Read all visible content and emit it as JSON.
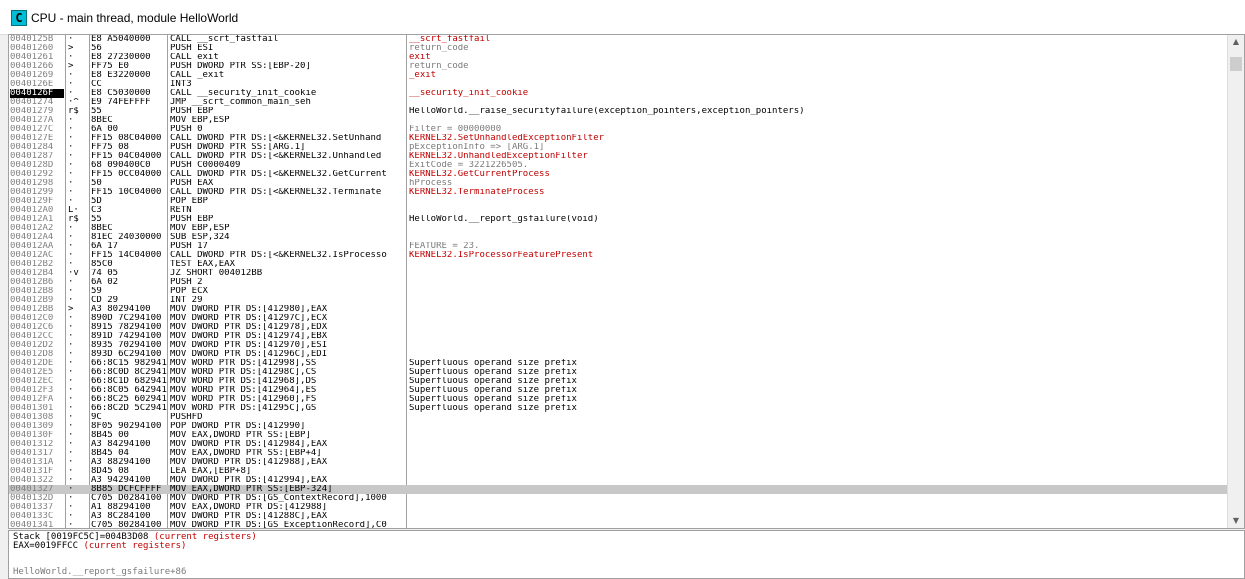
{
  "window": {
    "title": "CPU - main thread, module HelloWorld",
    "icon_letter": "C"
  },
  "disasm": [
    {
      "addr": "0040125B",
      "glyph": "·",
      "hex": "E8 A5040000",
      "dis": "CALL __scrt_fastfail",
      "comment": "__scrt_fastfail",
      "cstyle": "red"
    },
    {
      "addr": "00401260",
      "glyph": ">",
      "hex": "56",
      "dis": "PUSH ESI",
      "comment": "return_code",
      "cstyle": "gray"
    },
    {
      "addr": "00401261",
      "glyph": "·",
      "hex": "E8 27230000",
      "dis": "CALL exit",
      "comment": "exit",
      "cstyle": "red"
    },
    {
      "addr": "00401266",
      "glyph": ">",
      "hex": "FF75 E0",
      "dis": "PUSH DWORD PTR SS:[EBP-20]",
      "comment": "return_code",
      "cstyle": "gray"
    },
    {
      "addr": "00401269",
      "glyph": "·",
      "hex": "E8 E3220000",
      "dis": "CALL _exit",
      "comment": "_exit",
      "cstyle": "red"
    },
    {
      "addr": "0040126E",
      "glyph": "·",
      "hex": "CC",
      "dis": "INT3",
      "comment": "",
      "cstyle": ""
    },
    {
      "addr": "0040126F",
      "glyph": "·",
      "hex": "E8 C5030000",
      "dis": "CALL __security_init_cookie",
      "comment": "__security_init_cookie",
      "cstyle": "red"
    },
    {
      "addr": "00401274",
      "glyph": "·^",
      "hex": "E9 74FEFFFF",
      "dis": "JMP __scrt_common_main_seh",
      "comment": "",
      "cstyle": ""
    },
    {
      "addr": "00401279",
      "glyph": "r$",
      "hex": "55",
      "dis": "PUSH EBP",
      "comment": "HelloWorld.__raise_securityfailure(exception_pointers,exception_pointers)",
      "cstyle": ""
    },
    {
      "addr": "0040127A",
      "glyph": "·",
      "hex": "8BEC",
      "dis": "MOV EBP,ESP",
      "comment": "",
      "cstyle": ""
    },
    {
      "addr": "0040127C",
      "glyph": "·",
      "hex": "6A 00",
      "dis": "PUSH 0",
      "comment": "Filter = 00000000",
      "cstyle": "gray"
    },
    {
      "addr": "0040127E",
      "glyph": "·",
      "hex": "FF15 08C04000",
      "dis": "CALL DWORD PTR DS:[<&KERNEL32.SetUnhand",
      "comment": "KERNEL32.SetUnhandledExceptionFilter",
      "cstyle": "red"
    },
    {
      "addr": "00401284",
      "glyph": "·",
      "hex": "FF75 08",
      "dis": "PUSH DWORD PTR SS:[ARG.1]",
      "comment": "pExceptionInfo => [ARG.1]",
      "cstyle": "gray"
    },
    {
      "addr": "00401287",
      "glyph": "·",
      "hex": "FF15 04C04000",
      "dis": "CALL DWORD PTR DS:[<&KERNEL32.Unhandled",
      "comment": "KERNEL32.UnhandledExceptionFilter",
      "cstyle": "red"
    },
    {
      "addr": "0040128D",
      "glyph": "·",
      "hex": "68 090400C0",
      "dis": "PUSH C0000409",
      "comment": "ExitCode = 3221226505.",
      "cstyle": "gray"
    },
    {
      "addr": "00401292",
      "glyph": "·",
      "hex": "FF15 0CC04000",
      "dis": "CALL DWORD PTR DS:[<&KERNEL32.GetCurrent",
      "comment": "KERNEL32.GetCurrentProcess",
      "cstyle": "red"
    },
    {
      "addr": "00401298",
      "glyph": "·",
      "hex": "50",
      "dis": "PUSH EAX",
      "comment": "hProcess",
      "cstyle": "gray"
    },
    {
      "addr": "00401299",
      "glyph": "·",
      "hex": "FF15 10C04000",
      "dis": "CALL DWORD PTR DS:[<&KERNEL32.Terminate",
      "comment": "KERNEL32.TerminateProcess",
      "cstyle": "red"
    },
    {
      "addr": "0040129F",
      "glyph": "·",
      "hex": "5D",
      "dis": "POP EBP",
      "comment": "",
      "cstyle": ""
    },
    {
      "addr": "004012A0",
      "glyph": "L·",
      "hex": "C3",
      "dis": "RETN",
      "comment": "",
      "cstyle": ""
    },
    {
      "addr": "004012A1",
      "glyph": "r$",
      "hex": "55",
      "dis": "PUSH EBP",
      "comment": "HelloWorld.__report_gsfailure(void)",
      "cstyle": ""
    },
    {
      "addr": "004012A2",
      "glyph": "·",
      "hex": "8BEC",
      "dis": "MOV EBP,ESP",
      "comment": "",
      "cstyle": ""
    },
    {
      "addr": "004012A4",
      "glyph": "·",
      "hex": "81EC 24030000",
      "dis": "SUB ESP,324",
      "comment": "",
      "cstyle": ""
    },
    {
      "addr": "004012AA",
      "glyph": "·",
      "hex": "6A 17",
      "dis": "PUSH 17",
      "comment": "FEATURE = 23.",
      "cstyle": "gray"
    },
    {
      "addr": "004012AC",
      "glyph": "·",
      "hex": "FF15 14C04000",
      "dis": "CALL DWORD PTR DS:[<&KERNEL32.IsProcesso",
      "comment": "KERNEL32.IsProcessorFeaturePresent",
      "cstyle": "red"
    },
    {
      "addr": "004012B2",
      "glyph": "·",
      "hex": "85C0",
      "dis": "TEST EAX,EAX",
      "comment": "",
      "cstyle": ""
    },
    {
      "addr": "004012B4",
      "glyph": "·v",
      "hex": "74 05",
      "dis": "JZ SHORT 004012BB",
      "comment": "",
      "cstyle": ""
    },
    {
      "addr": "004012B6",
      "glyph": "·",
      "hex": "6A 02",
      "dis": "PUSH 2",
      "comment": "",
      "cstyle": ""
    },
    {
      "addr": "004012B8",
      "glyph": "·",
      "hex": "59",
      "dis": "POP ECX",
      "comment": "",
      "cstyle": ""
    },
    {
      "addr": "004012B9",
      "glyph": "·",
      "hex": "CD 29",
      "dis": "INT 29",
      "comment": "",
      "cstyle": ""
    },
    {
      "addr": "004012BB",
      "glyph": ">",
      "hex": "A3 80294100",
      "dis": "MOV DWORD PTR DS:[412980],EAX",
      "comment": "",
      "cstyle": ""
    },
    {
      "addr": "004012C0",
      "glyph": "·",
      "hex": "890D 7C294100",
      "dis": "MOV DWORD PTR DS:[41297C],ECX",
      "comment": "",
      "cstyle": ""
    },
    {
      "addr": "004012C6",
      "glyph": "·",
      "hex": "8915 78294100",
      "dis": "MOV DWORD PTR DS:[412978],EDX",
      "comment": "",
      "cstyle": ""
    },
    {
      "addr": "004012CC",
      "glyph": "·",
      "hex": "891D 74294100",
      "dis": "MOV DWORD PTR DS:[412974],EBX",
      "comment": "",
      "cstyle": ""
    },
    {
      "addr": "004012D2",
      "glyph": "·",
      "hex": "8935 70294100",
      "dis": "MOV DWORD PTR DS:[412970],ESI",
      "comment": "",
      "cstyle": ""
    },
    {
      "addr": "004012D8",
      "glyph": "·",
      "hex": "893D 6C294100",
      "dis": "MOV DWORD PTR DS:[41296C],EDI",
      "comment": "",
      "cstyle": ""
    },
    {
      "addr": "004012DE",
      "glyph": "·",
      "hex": "66:8C15 98294100",
      "dis": "MOV WORD PTR DS:[412998],SS",
      "comment": "Superfluous operand size prefix",
      "cstyle": ""
    },
    {
      "addr": "004012E5",
      "glyph": "·",
      "hex": "66:8C0D 8C294100",
      "dis": "MOV WORD PTR DS:[41298C],CS",
      "comment": "Superfluous operand size prefix",
      "cstyle": ""
    },
    {
      "addr": "004012EC",
      "glyph": "·",
      "hex": "66:8C1D 68294100",
      "dis": "MOV WORD PTR DS:[412968],DS",
      "comment": "Superfluous operand size prefix",
      "cstyle": ""
    },
    {
      "addr": "004012F3",
      "glyph": "·",
      "hex": "66:8C05 64294100",
      "dis": "MOV WORD PTR DS:[412964],ES",
      "comment": "Superfluous operand size prefix",
      "cstyle": ""
    },
    {
      "addr": "004012FA",
      "glyph": "·",
      "hex": "66:8C25 60294100",
      "dis": "MOV WORD PTR DS:[412960],FS",
      "comment": "Superfluous operand size prefix",
      "cstyle": ""
    },
    {
      "addr": "00401301",
      "glyph": "·",
      "hex": "66:8C2D 5C294100",
      "dis": "MOV WORD PTR DS:[41295C],GS",
      "comment": "Superfluous operand size prefix",
      "cstyle": ""
    },
    {
      "addr": "00401308",
      "glyph": "·",
      "hex": "9C",
      "dis": "PUSHFD",
      "comment": "",
      "cstyle": ""
    },
    {
      "addr": "00401309",
      "glyph": "·",
      "hex": "8F05 90294100",
      "dis": "POP DWORD PTR DS:[412990]",
      "comment": "",
      "cstyle": ""
    },
    {
      "addr": "0040130F",
      "glyph": "·",
      "hex": "8B45 00",
      "dis": "MOV EAX,DWORD PTR SS:[EBP]",
      "comment": "",
      "cstyle": ""
    },
    {
      "addr": "00401312",
      "glyph": "·",
      "hex": "A3 84294100",
      "dis": "MOV DWORD PTR DS:[412984],EAX",
      "comment": "",
      "cstyle": ""
    },
    {
      "addr": "00401317",
      "glyph": "·",
      "hex": "8B45 04",
      "dis": "MOV EAX,DWORD PTR SS:[EBP+4]",
      "comment": "",
      "cstyle": ""
    },
    {
      "addr": "0040131A",
      "glyph": "·",
      "hex": "A3 88294100",
      "dis": "MOV DWORD PTR DS:[412988],EAX",
      "comment": "",
      "cstyle": ""
    },
    {
      "addr": "0040131F",
      "glyph": "·",
      "hex": "8D45 08",
      "dis": "LEA EAX,[EBP+8]",
      "comment": "",
      "cstyle": ""
    },
    {
      "addr": "00401322",
      "glyph": "·",
      "hex": "A3 94294100",
      "dis": "MOV DWORD PTR DS:[412994],EAX",
      "comment": "",
      "cstyle": ""
    },
    {
      "addr": "00401327",
      "glyph": "·",
      "hex": "8B85 DCFCFFFF",
      "dis": "MOV EAX,DWORD PTR SS:[EBP-324]",
      "comment": "",
      "cstyle": ""
    },
    {
      "addr": "0040132D",
      "glyph": "·",
      "hex": "C705 D0284100",
      "dis": "MOV DWORD PTR DS:[GS_ContextRecord],1000",
      "comment": "",
      "cstyle": ""
    },
    {
      "addr": "00401337",
      "glyph": "·",
      "hex": "A1 88294100",
      "dis": "MOV EAX,DWORD PTR DS:[412988]",
      "comment": "",
      "cstyle": ""
    },
    {
      "addr": "0040133C",
      "glyph": "·",
      "hex": "A3 8C284100",
      "dis": "MOV DWORD PTR DS:[41288C],EAX",
      "comment": "",
      "cstyle": ""
    },
    {
      "addr": "00401341",
      "glyph": "·",
      "hex": "C705 80284100",
      "dis": "MOV DWORD PTR DS:[GS_ExceptionRecord],C0",
      "comment": "",
      "cstyle": ""
    }
  ],
  "current_row": 6,
  "selected_row": 50,
  "info": {
    "stack_text": "Stack [0019FC5C]=004B3D08",
    "stack_note": "(current registers)",
    "eax_text": "EAX=0019FFCC",
    "eax_note": "(current registers)",
    "location": "HelloWorld.__report_gsfailure+86"
  },
  "colors": {
    "comment_red": "#c00000",
    "comment_gray": "#7a7a7a",
    "address_gray": "#808080",
    "selection_gray": "#c8c8c8"
  }
}
